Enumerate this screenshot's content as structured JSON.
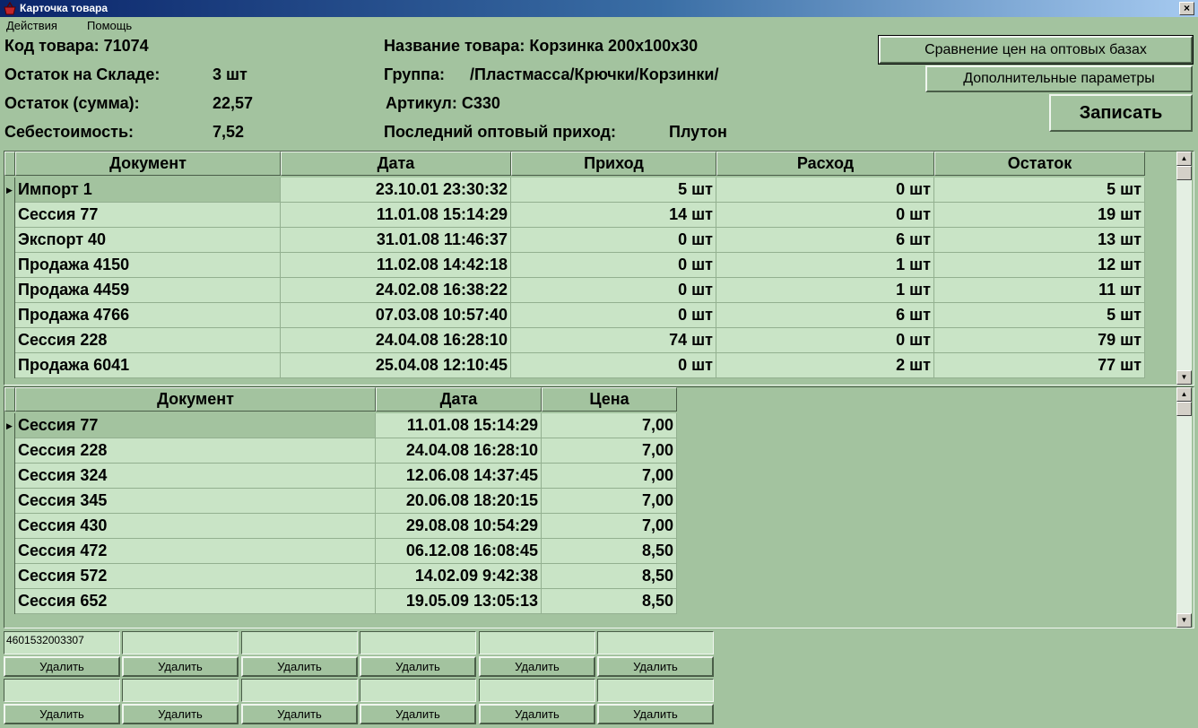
{
  "window": {
    "title": "Карточка товара",
    "close_glyph": "×"
  },
  "menu": [
    "Действия",
    "Помощь"
  ],
  "info": {
    "code_label": "Код товара:",
    "code_value": "71074",
    "stock_label": "Остаток на Складе:",
    "stock_value": "3 шт",
    "sum_label": "Остаток (сумма):",
    "sum_value": "22,57",
    "cost_label": "Себестоимость:",
    "cost_value": "7,52",
    "name_label": "Название товара:",
    "name_value": "Корзинка 200х100х30",
    "group_label": "Группа:",
    "group_value": "/Пластмасса/Крючки/Корзинки/",
    "article_label": "Артикул:",
    "article_value": "С330",
    "last_label": "Последний оптовый приход:",
    "last_value": "Плутон"
  },
  "buttons": {
    "compare": "Сравнение цен на оптовых базах",
    "extra": "Дополнительные параметры",
    "save": "Записать"
  },
  "movements": {
    "columns": [
      "Документ",
      "Дата",
      "Приход",
      "Расход",
      "Остаток"
    ],
    "rows": [
      [
        "Импорт 1",
        "23.10.01 23:30:32",
        "5 шт",
        "0 шт",
        "5 шт"
      ],
      [
        "Сессия 77",
        "11.01.08 15:14:29",
        "14 шт",
        "0 шт",
        "19 шт"
      ],
      [
        "Экспорт 40",
        "31.01.08 11:46:37",
        "0 шт",
        "6 шт",
        "13 шт"
      ],
      [
        "Продажа 4150",
        "11.02.08 14:42:18",
        "0 шт",
        "1 шт",
        "12 шт"
      ],
      [
        "Продажа 4459",
        "24.02.08 16:38:22",
        "0 шт",
        "1 шт",
        "11 шт"
      ],
      [
        "Продажа 4766",
        "07.03.08 10:57:40",
        "0 шт",
        "6 шт",
        "5 шт"
      ],
      [
        "Сессия 228",
        "24.04.08 16:28:10",
        "74 шт",
        "0 шт",
        "79 шт"
      ],
      [
        "Продажа 6041",
        "25.04.08 12:10:45",
        "0 шт",
        "2 шт",
        "77 шт"
      ]
    ]
  },
  "prices": {
    "columns": [
      "Документ",
      "Дата",
      "Цена"
    ],
    "rows": [
      [
        "Сессия 77",
        "11.01.08 15:14:29",
        "7,00"
      ],
      [
        "Сессия 228",
        "24.04.08 16:28:10",
        "7,00"
      ],
      [
        "Сессия 324",
        "12.06.08 14:37:45",
        "7,00"
      ],
      [
        "Сессия 345",
        "20.06.08 18:20:15",
        "7,00"
      ],
      [
        "Сессия 430",
        "29.08.08 10:54:29",
        "7,00"
      ],
      [
        "Сессия 472",
        "06.12.08 16:08:45",
        "8,50"
      ],
      [
        "Сессия 572",
        "14.02.09 9:42:38",
        "8,50"
      ],
      [
        "Сессия 652",
        "19.05.09 13:05:13",
        "8,50"
      ]
    ]
  },
  "barcodes": {
    "row1": [
      "4601532003307",
      "",
      "",
      "",
      "",
      ""
    ],
    "row2": [
      "",
      "",
      "",
      "",
      "",
      ""
    ],
    "delete_label": "Удалить"
  },
  "colors": {
    "grid_cell": "#c9e4c6",
    "background": "#a3c39f",
    "titlebar": "#0a246a"
  }
}
